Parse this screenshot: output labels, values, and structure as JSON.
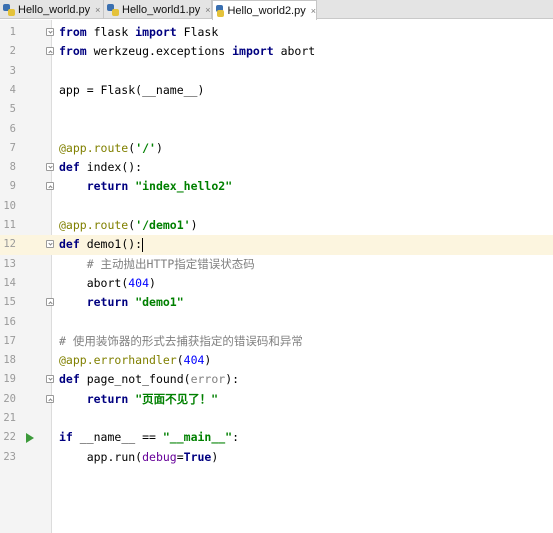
{
  "tabs": [
    {
      "label": "Hello_world.py",
      "active": false
    },
    {
      "label": "Hello_world1.py",
      "active": false
    },
    {
      "label": "Hello_world2.py",
      "active": true
    }
  ],
  "close_glyph": "×",
  "code_lines": [
    {
      "n": "1"
    },
    {
      "n": "2"
    },
    {
      "n": "3"
    },
    {
      "n": "4"
    },
    {
      "n": "5"
    },
    {
      "n": "6"
    },
    {
      "n": "7"
    },
    {
      "n": "8"
    },
    {
      "n": "9"
    },
    {
      "n": "10"
    },
    {
      "n": "11"
    },
    {
      "n": "12"
    },
    {
      "n": "13"
    },
    {
      "n": "14"
    },
    {
      "n": "15"
    },
    {
      "n": "16"
    },
    {
      "n": "17"
    },
    {
      "n": "18"
    },
    {
      "n": "19"
    },
    {
      "n": "20"
    },
    {
      "n": "21"
    },
    {
      "n": "22"
    },
    {
      "n": "23"
    }
  ],
  "code": {
    "l1": {
      "kw1": "from",
      "t1": " flask ",
      "kw2": "import",
      "t2": " Flask"
    },
    "l2": {
      "kw1": "from",
      "t1": " werkzeug.exceptions ",
      "kw2": "import",
      "t2": " abort"
    },
    "l4": {
      "t1": "app = Flask(__name__)"
    },
    "l7": {
      "deco": "@app.route",
      "t1": "(",
      "str": "'/'",
      "t2": ")"
    },
    "l8": {
      "kw": "def",
      "t1": " index():"
    },
    "l9": {
      "indent": "    ",
      "kw": "return",
      "t1": " ",
      "str": "\"index_hello2\""
    },
    "l11": {
      "deco": "@app.route",
      "t1": "(",
      "str": "'/demo1'",
      "t2": ")"
    },
    "l12": {
      "kw": "def",
      "t1": " demo1():"
    },
    "l13": {
      "indent": "    ",
      "cmt": "# 主动抛出HTTP指定错误状态码"
    },
    "l14": {
      "indent": "    ",
      "t1": "abort(",
      "num": "404",
      "t2": ")"
    },
    "l15": {
      "indent": "    ",
      "kw": "return",
      "t1": " ",
      "str": "\"demo1\""
    },
    "l17": {
      "cmt": "# 使用装饰器的形式去捕获指定的错误码和异常"
    },
    "l18": {
      "deco": "@app.errorhandler",
      "t1": "(",
      "num": "404",
      "t2": ")"
    },
    "l19": {
      "kw": "def",
      "t1": " page_not_found(",
      "param": "error",
      "t2": "):"
    },
    "l20": {
      "indent": "    ",
      "kw": "return",
      "t1": " ",
      "str": "\"页面不见了！\""
    },
    "l22": {
      "kw": "if",
      "t1": " __name__ == ",
      "str": "\"__main__\"",
      "t2": ":"
    },
    "l23": {
      "indent": "    ",
      "t1": "app.run(",
      "kwarg": "debug",
      "t2": "=",
      "kw": "True",
      "t3": ")"
    }
  },
  "colors": {
    "keyword": "#000080",
    "string": "#008000",
    "decorator": "#808000",
    "number": "#0000ff",
    "comment": "#808080",
    "current_line": "#fcf5df",
    "run_icon": "#3c9a3a"
  }
}
